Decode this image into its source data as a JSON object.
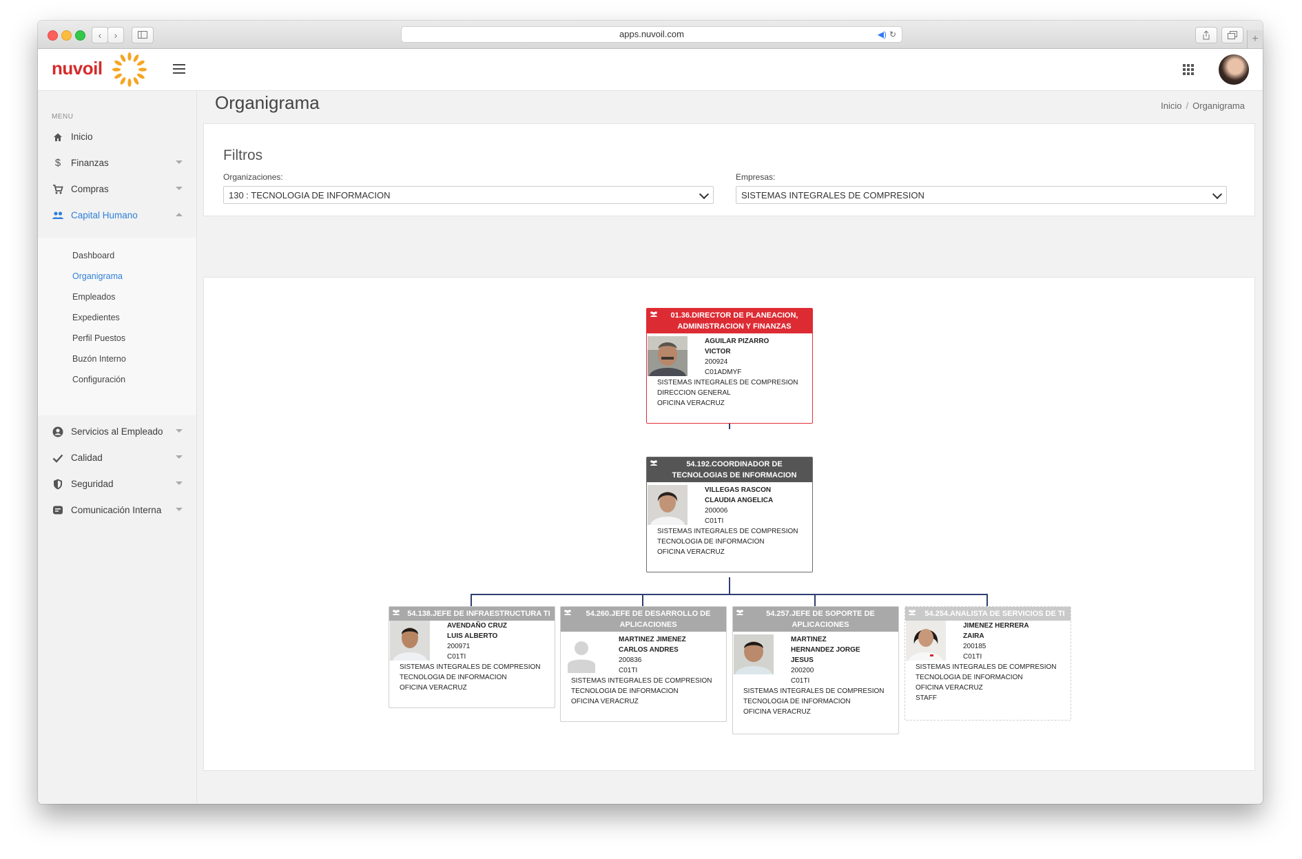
{
  "browser": {
    "url": "apps.nuvoil.com"
  },
  "brand": {
    "name": "nuvoil",
    "color": "#d62a2a",
    "sun_color": "#f5a623"
  },
  "sidebar": {
    "caption": "MENU",
    "items": [
      {
        "label": "Inicio",
        "icon": "home-icon"
      },
      {
        "label": "Finanzas",
        "icon": "dollar-icon"
      },
      {
        "label": "Compras",
        "icon": "cart-icon"
      },
      {
        "label": "Capital Humano",
        "icon": "people-icon"
      },
      {
        "label": "Servicios al Empleado",
        "icon": "account-circle-icon"
      },
      {
        "label": "Calidad",
        "icon": "check-icon"
      },
      {
        "label": "Seguridad",
        "icon": "shield-icon"
      },
      {
        "label": "Comunicación Interna",
        "icon": "chat-icon"
      }
    ],
    "sub_items": [
      "Dashboard",
      "Organigrama",
      "Empleados",
      "Expedientes",
      "Perfil Puestos",
      "Buzón Interno",
      "Configuración"
    ],
    "active_color": "#2f7fd8"
  },
  "page": {
    "title": "Organigrama",
    "breadcrumb": {
      "home": "Inicio",
      "current": "Organigrama"
    }
  },
  "filters": {
    "title": "Filtros",
    "organizaciones_label": "Organizaciones:",
    "organizaciones_value": "130 : TECNOLOGIA DE INFORMACION",
    "empresas_label": "Empresas:",
    "empresas_value": "SISTEMAS INTEGRALES DE COMPRESION"
  },
  "org": {
    "director": {
      "title": "01.36.DIRECTOR DE PLANEACION, ADMINISTRACION Y FINANZAS",
      "lines": [
        "AGUILAR PIZARRO",
        "VICTOR",
        "200924",
        "C01ADMYF"
      ],
      "extra": [
        "SISTEMAS INTEGRALES DE COMPRESION",
        "DIRECCION GENERAL",
        "OFICINA VERACRUZ"
      ]
    },
    "coordinador": {
      "title": "54.192.COORDINADOR DE TECNOLOGIAS DE INFORMACION",
      "lines": [
        "VILLEGAS RASCON",
        "CLAUDIA ANGELICA",
        "200006",
        "C01TI"
      ],
      "extra": [
        "SISTEMAS INTEGRALES DE COMPRESION",
        "TECNOLOGIA DE INFORMACION",
        "OFICINA VERACRUZ"
      ]
    },
    "children": [
      {
        "title": "54.138.JEFE DE INFRAESTRUCTURA TI",
        "lines": [
          "AVENDAÑO CRUZ",
          "LUIS ALBERTO",
          "200971",
          "C01TI"
        ],
        "extra": [
          "SISTEMAS INTEGRALES DE COMPRESION",
          "TECNOLOGIA DE INFORMACION",
          "OFICINA VERACRUZ"
        ]
      },
      {
        "title": "54.260.JEFE DE DESARROLLO DE APLICACIONES",
        "lines": [
          "MARTINEZ JIMENEZ",
          "CARLOS ANDRES",
          "200836",
          "C01TI"
        ],
        "extra": [
          "SISTEMAS INTEGRALES DE COMPRESION",
          "TECNOLOGIA DE INFORMACION",
          "OFICINA VERACRUZ"
        ]
      },
      {
        "title": "54.257.JEFE DE SOPORTE DE APLICACIONES",
        "lines": [
          "MARTINEZ",
          "HERNANDEZ JORGE",
          "JESUS",
          "200200",
          "C01TI"
        ],
        "extra": [
          "SISTEMAS INTEGRALES DE COMPRESION",
          "TECNOLOGIA DE INFORMACION",
          "OFICINA VERACRUZ"
        ]
      },
      {
        "title": "54.254.ANALISTA DE SERVICIOS DE TI",
        "lines": [
          "JIMENEZ HERRERA",
          "ZAIRA",
          "200185",
          "C01TI"
        ],
        "extra": [
          "SISTEMAS INTEGRALES DE COMPRESION",
          "TECNOLOGIA DE INFORMACION",
          "OFICINA VERACRUZ",
          "STAFF"
        ]
      }
    ],
    "colors": {
      "director": "#dd2b34",
      "coordinador": "#555555",
      "jefe": "#a9a9a9",
      "staff": "#c9c9c9",
      "connector": "#2d3f73"
    }
  }
}
